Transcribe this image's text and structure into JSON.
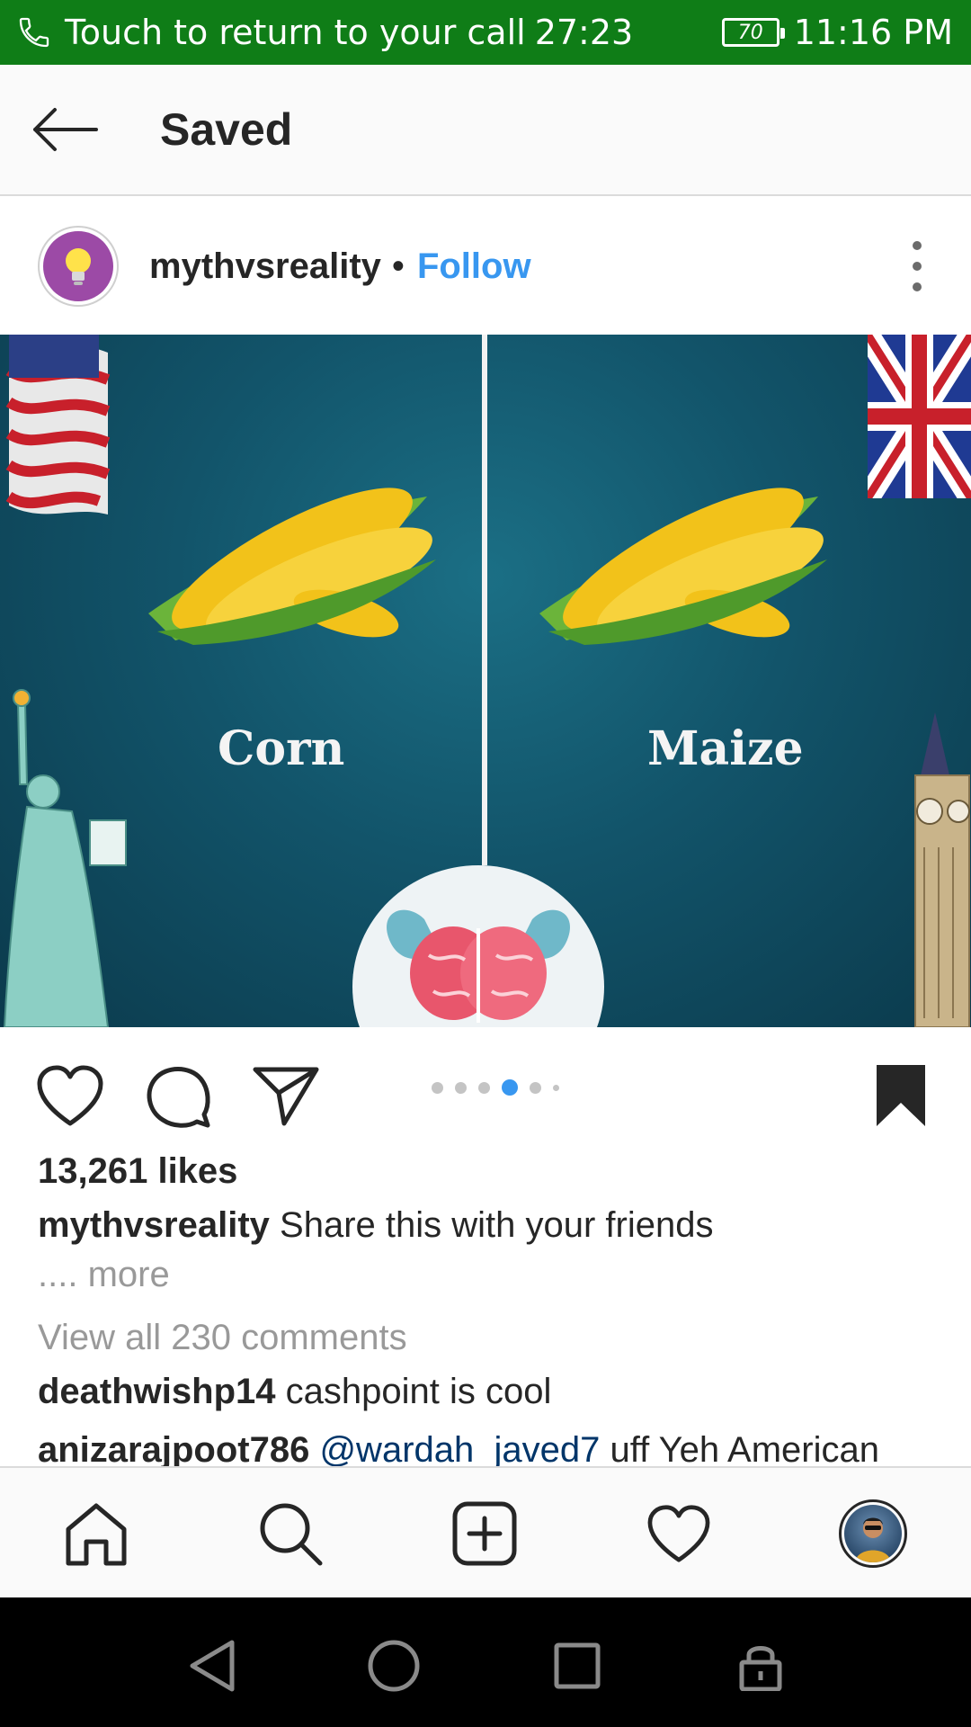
{
  "status_bar": {
    "call_text": "Touch to return to your call",
    "call_timer": "27:23",
    "battery": "70",
    "time": "11:16 PM"
  },
  "header": {
    "title": "Saved",
    "back_icon": "arrow-left-icon"
  },
  "post": {
    "username": "mythvsreality",
    "separator": "•",
    "follow_label": "Follow",
    "more_icon": "vertical-dots-icon",
    "image": {
      "left_word": "Corn",
      "right_word": "Maize"
    },
    "carousel": {
      "count": 6,
      "active_index": 3
    },
    "likes": "13,261 likes",
    "caption_user": "mythvsreality",
    "caption_text": "Share this with your friends",
    "caption_more": ".... more",
    "view_comments": "View all 230 comments",
    "comments": [
      {
        "user": "deathwishp14",
        "mention": "",
        "text": "cashpoint is cool"
      },
      {
        "user": "anizarajpoot786",
        "mention": "@wardah_javed7",
        "text": "uff Yeh American"
      }
    ]
  },
  "colors": {
    "status_green": "#0f7d17",
    "link_blue": "#3897f0",
    "mention_blue": "#003569",
    "muted_grey": "#999999"
  },
  "tabbar": {
    "items": [
      "home-icon",
      "search-icon",
      "new-post-icon",
      "activity-heart-icon",
      "profile-avatar"
    ]
  },
  "system_nav": {
    "items": [
      "back-triangle-icon",
      "home-circle-icon",
      "recents-square-icon",
      "lock-icon"
    ]
  }
}
